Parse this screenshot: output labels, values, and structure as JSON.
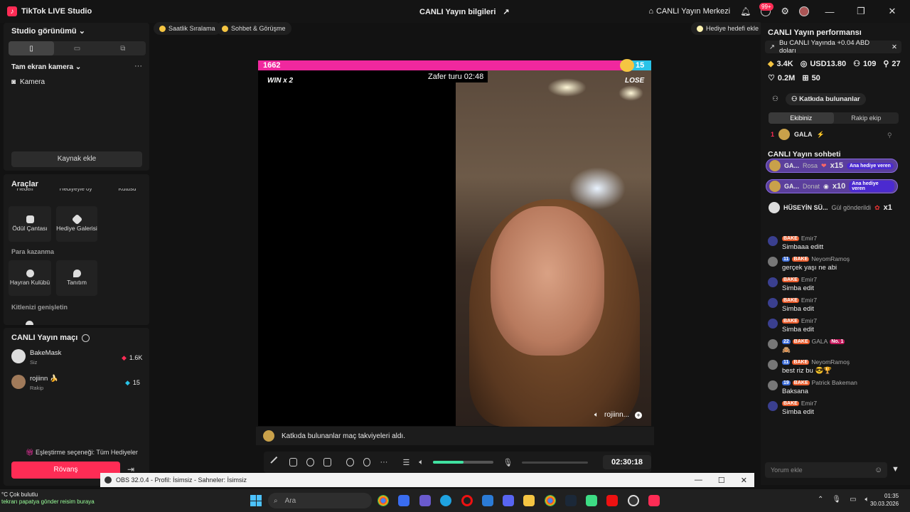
{
  "titlebar": {
    "app_title": "TikTok LIVE Studio",
    "center_title": "CANLI Yayın bilgileri",
    "live_center": "CANLI Yayın Merkezi",
    "notif_badge": "99+"
  },
  "left": {
    "studio_view": "Studio görünümü",
    "fullscreen_camera": "Tam ekran kamera",
    "camera_source": "Kamera",
    "add_source": "Kaynak ekle",
    "tools_title": "Araçlar",
    "cut_labels": [
      "Hedefi",
      "Hediyeyle oy",
      "Kutusu"
    ],
    "tools": [
      {
        "label": "Ödül Çantası",
        "icon": "bag-icon"
      },
      {
        "label": "Hediye Galerisi",
        "icon": "gift-gallery-icon"
      }
    ],
    "earn_title": "Para kazanma",
    "earn_tools": [
      {
        "label": "Hayran Kulübü",
        "icon": "heart-icon"
      },
      {
        "label": "Tanıtım",
        "icon": "flame-icon"
      }
    ],
    "expand_title": "Kitlenizi genişletin",
    "match_title": "CANLI Yayın maçı",
    "players": [
      {
        "name": "BakeMask",
        "role": "Siz",
        "score": "1.6K"
      },
      {
        "name": "rojiinn",
        "role": "Rakip",
        "score": "15"
      }
    ],
    "match_option": "Eşleştirme seçeneği: Tüm Hediyeler",
    "rematch": "Rövanş"
  },
  "pills": {
    "hourly": "Saatlik Sıralama",
    "chat_meet": "Sohbet & Görüşme",
    "gift_goal": "Hediye hedefi ekle"
  },
  "battle": {
    "score_left": "1662",
    "score_right": "15",
    "win_label": "WIN x 2",
    "lose_label": "LOSE",
    "timer": "Zafer turu 02:48",
    "opponent_name": "rojiinn...",
    "notice": "Katkıda bulunanlar maç takviyeleri aldı.",
    "elapsed": "02:30:18",
    "volume_fraction": 0.5
  },
  "right": {
    "perf_title": "CANLI Yayın performansı",
    "banner": "Bu CANLI Yayında +0.04 ABD doları",
    "stats": {
      "diamonds": "3.4K",
      "usd": "USD13.80",
      "viewers": "109",
      "followers": "27",
      "likes": "0.2M",
      "gifts": "50"
    },
    "contributors_label": "Katkıda bulunanlar",
    "tab_team": "Ekibiniz",
    "tab_opponent": "Rakip ekip",
    "top_rank": "1",
    "top_name": "GALA",
    "chat_title": "CANLI Yayın sohbeti",
    "gift_rows": [
      {
        "name": "GA...",
        "who": "Rosa",
        "count": "x15",
        "tag": "Ana hediye veren"
      },
      {
        "name": "GA...",
        "who": "Donat",
        "count": "x10",
        "tag": "Ana hediye veren"
      }
    ],
    "rose_row": {
      "name": "HÜSEYİN SÜ...",
      "action": "Gül gönderildi",
      "count": "x1"
    },
    "messages": [
      {
        "lvl": "",
        "team": "BAKE",
        "user": "Emir7",
        "text": "Simbaaa editt"
      },
      {
        "lvl": "11",
        "team": "BAKE",
        "user": "NeyomRamoş",
        "text": "gerçek yaşı ne abi"
      },
      {
        "lvl": "",
        "team": "BAKE",
        "user": "Emir7",
        "text": "Simba edit"
      },
      {
        "lvl": "",
        "team": "BAKE",
        "user": "Emir7",
        "text": "Simba edit"
      },
      {
        "lvl": "",
        "team": "BAKE",
        "user": "Emir7",
        "text": "Simba edit"
      },
      {
        "lvl": "22",
        "team": "BAKE",
        "user": "GALA",
        "text": "🙈",
        "extra": "No. 1"
      },
      {
        "lvl": "11",
        "team": "BAKE",
        "user": "NeyomRamoş",
        "text": "best riz bu 😎🏆"
      },
      {
        "lvl": "19",
        "team": "BAKE",
        "user": "Patrick Bakeman",
        "text": "Baksana"
      },
      {
        "lvl": "",
        "team": "BAKE",
        "user": "Emir7",
        "text": "Simba edit"
      }
    ],
    "comment_placeholder": "Yorum ekle"
  },
  "obs": {
    "title": "OBS 32.0.4 - Profil: İsimsiz - Sahneler: İsimsiz"
  },
  "taskbar": {
    "search_placeholder": "Ara",
    "weather_temp": "°C",
    "weather_desc": "Çok bulutlu",
    "ticker": "tekrarı papatya gönder reisim buraya",
    "time": "01:35",
    "date": "30.03.2026"
  }
}
